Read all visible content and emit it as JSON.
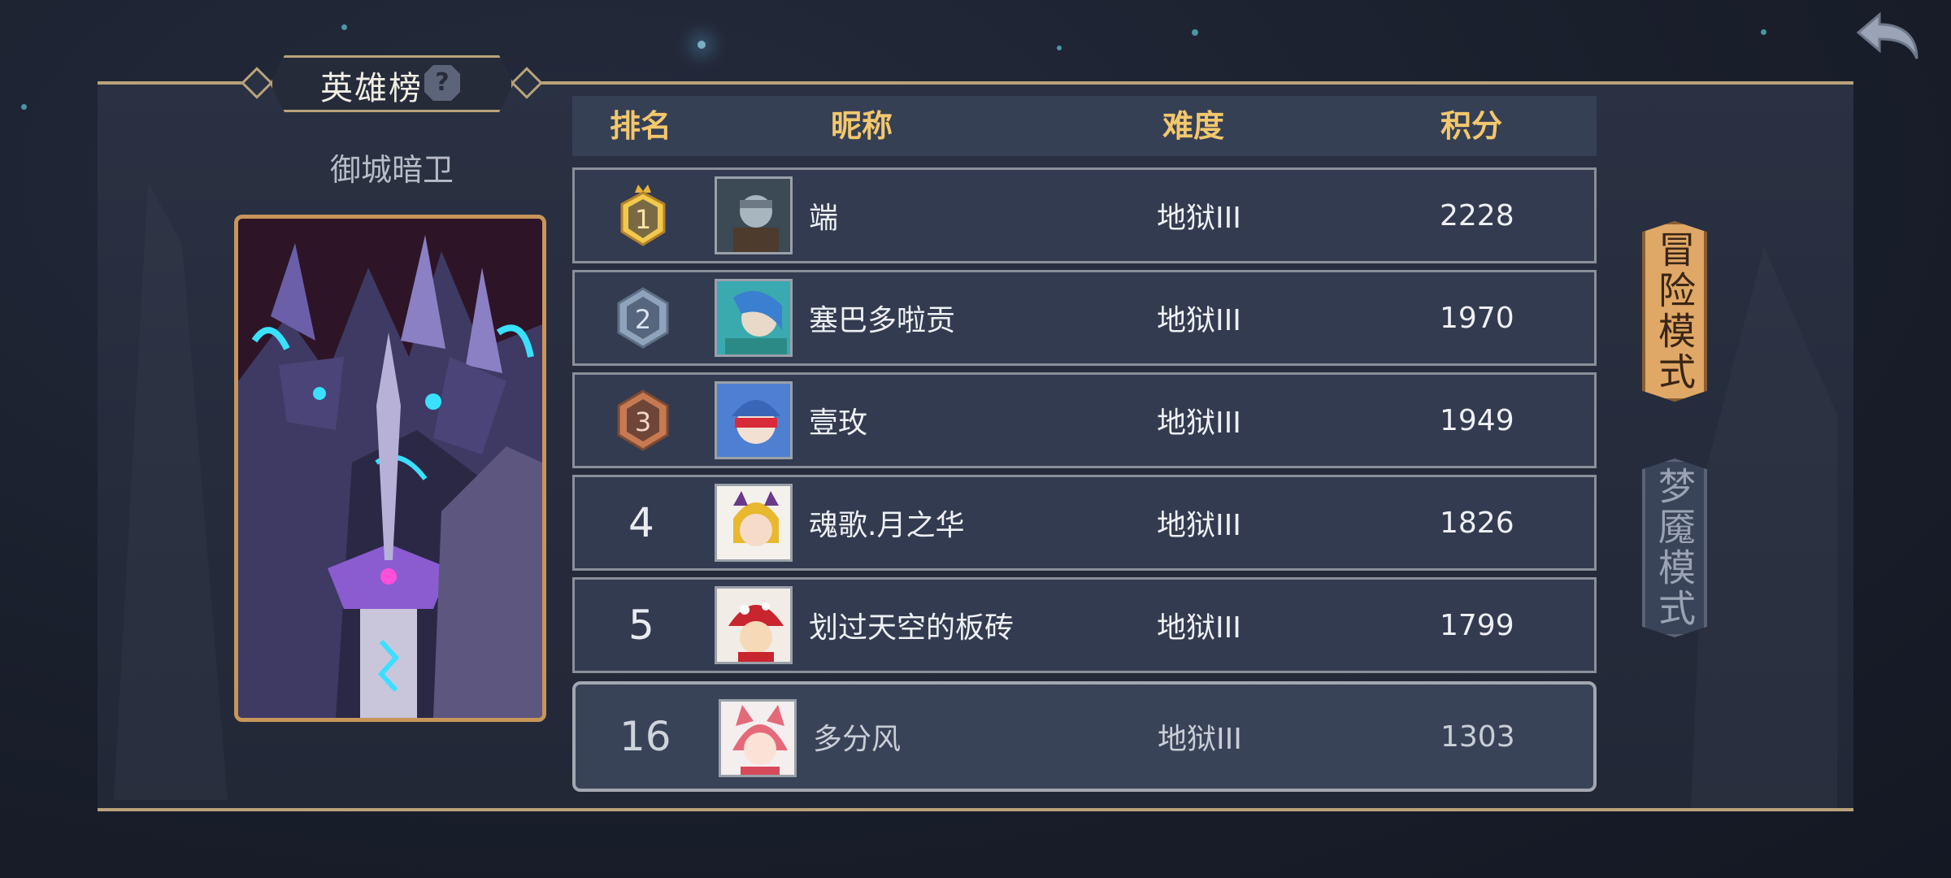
{
  "leaderboard": {
    "title": "英雄榜",
    "help_icon": "question-mark-icon",
    "hero_name": "御城暗卫",
    "columns": {
      "rank": "排名",
      "nickname": "昵称",
      "difficulty": "难度",
      "score": "积分"
    },
    "rows": [
      {
        "rank": "1",
        "nickname": "端",
        "difficulty": "地狱III",
        "score": "2228",
        "badge": "gold-crown-badge"
      },
      {
        "rank": "2",
        "nickname": "塞巴多啦贡",
        "difficulty": "地狱III",
        "score": "1970",
        "badge": "silver-badge"
      },
      {
        "rank": "3",
        "nickname": "壹玫",
        "difficulty": "地狱III",
        "score": "1949",
        "badge": "bronze-badge"
      },
      {
        "rank": "4",
        "nickname": "魂歌.月之华",
        "difficulty": "地狱III",
        "score": "1826"
      },
      {
        "rank": "5",
        "nickname": "划过天空的板砖",
        "difficulty": "地狱III",
        "score": "1799"
      }
    ],
    "my_row": {
      "rank": "16",
      "nickname": "多分风",
      "difficulty": "地狱III",
      "score": "1303"
    }
  },
  "modes": {
    "adventure": "冒险模式",
    "nightmare": "梦魇模式",
    "active": "adventure"
  },
  "nav": {
    "back_icon": "back-arrow-icon"
  },
  "colors": {
    "gold": "#f3c76c",
    "frame": "#b9a37a",
    "active_mode": "#e0a866"
  }
}
